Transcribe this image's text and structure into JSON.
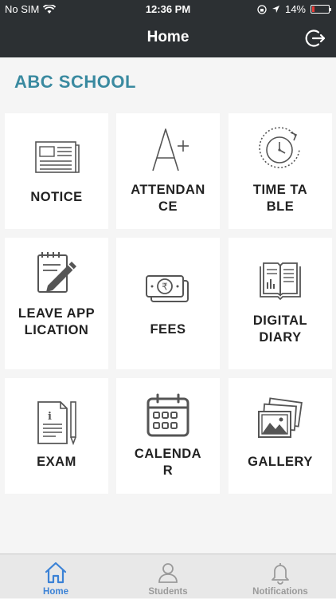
{
  "status": {
    "carrier": "No SIM",
    "time": "12:36 PM",
    "battery": "14%",
    "battery_level": 0.14
  },
  "nav": {
    "title": "Home",
    "logout_icon": "logout-icon"
  },
  "school_name": "ABC SCHOOL",
  "tiles": [
    {
      "label": "NOTICE",
      "icon": "newspaper-icon"
    },
    {
      "label": "ATTENDANCE",
      "icon": "a-plus-icon"
    },
    {
      "label": "TIME TABLE",
      "icon": "clock-icon"
    },
    {
      "label": "LEAVE APPLICATION",
      "icon": "notepad-pencil-icon"
    },
    {
      "label": "FEES",
      "icon": "rupee-banknote-icon"
    },
    {
      "label": "DIGITAL DIARY",
      "icon": "diary-icon"
    },
    {
      "label": "EXAM",
      "icon": "exam-paper-icon"
    },
    {
      "label": "CALENDAR",
      "icon": "calendar-icon"
    },
    {
      "label": "GALLERY",
      "icon": "gallery-icon"
    }
  ],
  "tabbar": {
    "home": "Home",
    "students": "Students",
    "notifications": "Notifications"
  },
  "colors": {
    "header": "#2c3033",
    "accent": "#3a8aa0",
    "active_tab": "#3b82d6",
    "icon_stroke": "#555555"
  }
}
